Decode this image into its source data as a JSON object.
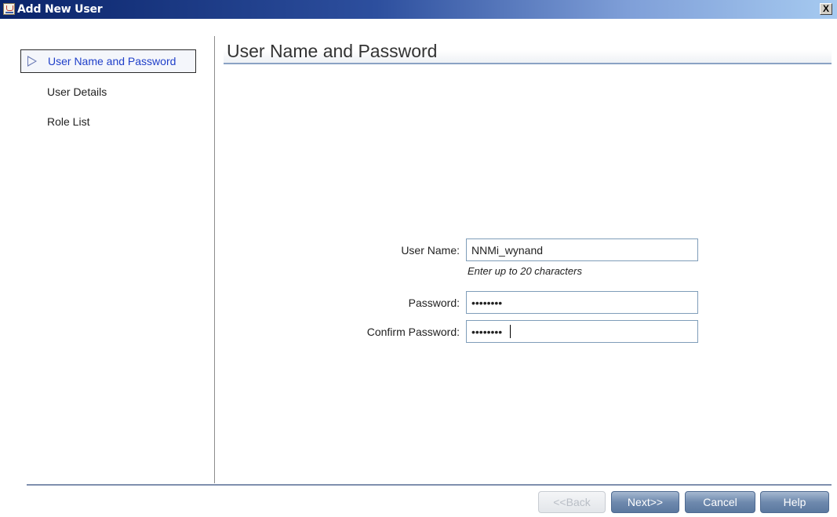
{
  "window": {
    "title": "Add New User",
    "close_label": "X"
  },
  "nav": {
    "items": [
      {
        "label": "User Name and Password",
        "active": true
      },
      {
        "label": "User Details",
        "active": false
      },
      {
        "label": "Role List",
        "active": false
      }
    ]
  },
  "panel": {
    "title": "User Name and Password"
  },
  "form": {
    "username": {
      "label": "User Name:",
      "value": "NNMi_wynand",
      "hint": "Enter up to 20 characters"
    },
    "password": {
      "label": "Password:",
      "value": "••••••••"
    },
    "confirm_password": {
      "label": "Confirm Password:",
      "value": "••••••••"
    }
  },
  "buttons": {
    "back": "<<Back",
    "next": "Next>>",
    "cancel": "Cancel",
    "help": "Help"
  },
  "colors": {
    "accent": "#1f3fc9",
    "button": "#6f8aae"
  }
}
